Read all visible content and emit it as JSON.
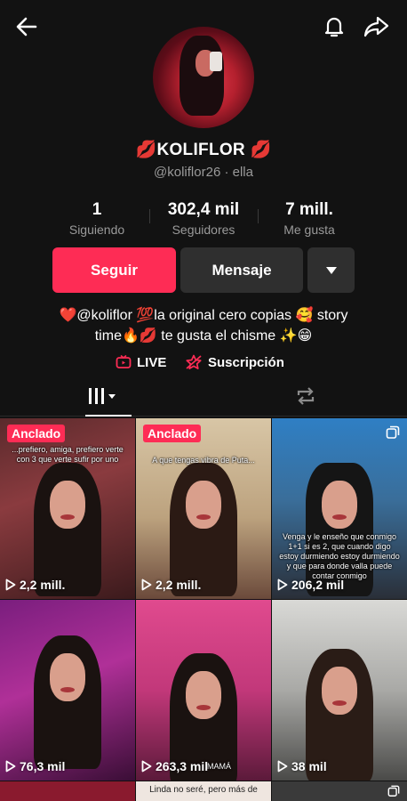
{
  "profile": {
    "name": "💋KOLIFLOR 💋",
    "handle": "@koliflor26 · ella",
    "stats": [
      {
        "value": "1",
        "label": "Siguiendo"
      },
      {
        "value": "302,4 mil",
        "label": "Seguidores"
      },
      {
        "value": "7 mill.",
        "label": "Me gusta"
      }
    ],
    "bio_line1": "❤️@koliflor 💯la original cero copias 🥰 story",
    "bio_line2": "time🔥💋 te gusta el chisme ✨😁"
  },
  "actions": {
    "follow_label": "Seguir",
    "message_label": "Mensaje"
  },
  "links": {
    "live_label": "LIVE",
    "subscription_label": "Suscripción"
  },
  "icons": {
    "back": "arrow-left-icon",
    "bell": "bell-icon",
    "share": "share-arrow-icon",
    "more": "triangle-down-icon",
    "grid": "grid-bars-icon",
    "repost": "repost-icon"
  },
  "colors": {
    "accent": "#fe2c55",
    "background": "#121212",
    "secondary_button": "#2f2f2f"
  },
  "videos": [
    {
      "pinned": true,
      "pin_label": "Anclado",
      "caption": "...prefiero, amiga, prefiero verte con 3 que verte sufir por uno",
      "views": "2,2 mill."
    },
    {
      "pinned": true,
      "pin_label": "Anclado",
      "caption": "A que tengas vibra de Puta...",
      "views": "2,2 mill."
    },
    {
      "pinned": false,
      "caption": "Venga y le enseño que conmigo 1+1 si es 2, que cuando digo estoy durmiendo estoy durmiendo y que para donde valla puede contar conmigo",
      "views": "206,2 mil"
    },
    {
      "pinned": false,
      "caption": "",
      "views": "76,3 mil"
    },
    {
      "pinned": false,
      "caption": "MAMÁ",
      "views": "263,3 mil"
    },
    {
      "pinned": false,
      "caption": "",
      "views": "38 mil"
    }
  ],
  "partial_row_caption": "Linda no seré, pero más de"
}
